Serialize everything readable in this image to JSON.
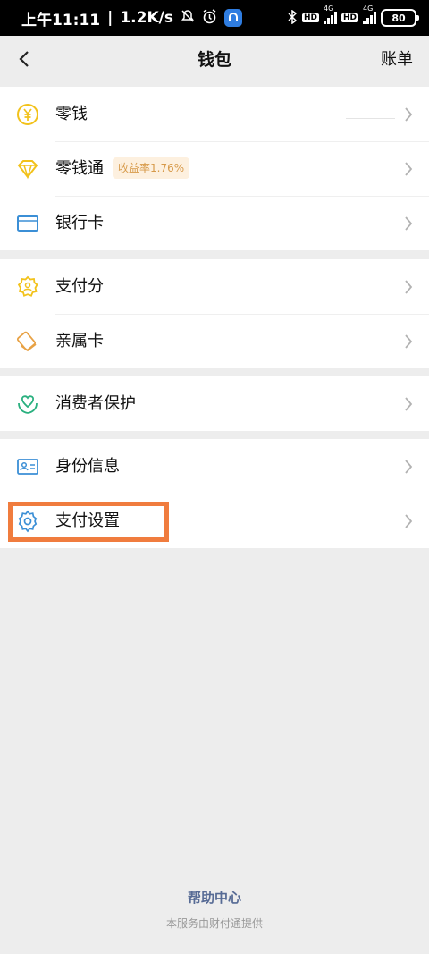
{
  "status_bar": {
    "time": "上午11:11",
    "speed": "1.2K/s",
    "hd1": "HD",
    "net1": "4G",
    "hd2": "HD",
    "net2": "4G",
    "battery": "80"
  },
  "nav": {
    "title": "钱包",
    "bill": "账单"
  },
  "colors": {
    "accent": "#f07c3e",
    "link": "#576b95",
    "badge_text": "#d79a4a",
    "badge_bg": "#fdf0df"
  },
  "groups": [
    {
      "items": [
        {
          "label": "零钱",
          "icon": "yuan-coin-icon"
        },
        {
          "label": "零钱通",
          "icon": "diamond-icon",
          "badge": "收益率1.76%"
        },
        {
          "label": "银行卡",
          "icon": "bank-card-icon"
        }
      ]
    },
    {
      "items": [
        {
          "label": "支付分",
          "icon": "pay-score-icon"
        },
        {
          "label": "亲属卡",
          "icon": "family-card-icon"
        }
      ]
    },
    {
      "items": [
        {
          "label": "消费者保护",
          "icon": "consumer-protection-icon"
        }
      ]
    },
    {
      "items": [
        {
          "label": "身份信息",
          "icon": "id-card-icon"
        },
        {
          "label": "支付设置",
          "icon": "gear-icon"
        }
      ]
    }
  ],
  "footer": {
    "help": "帮助中心",
    "note": "本服务由财付通提供"
  }
}
